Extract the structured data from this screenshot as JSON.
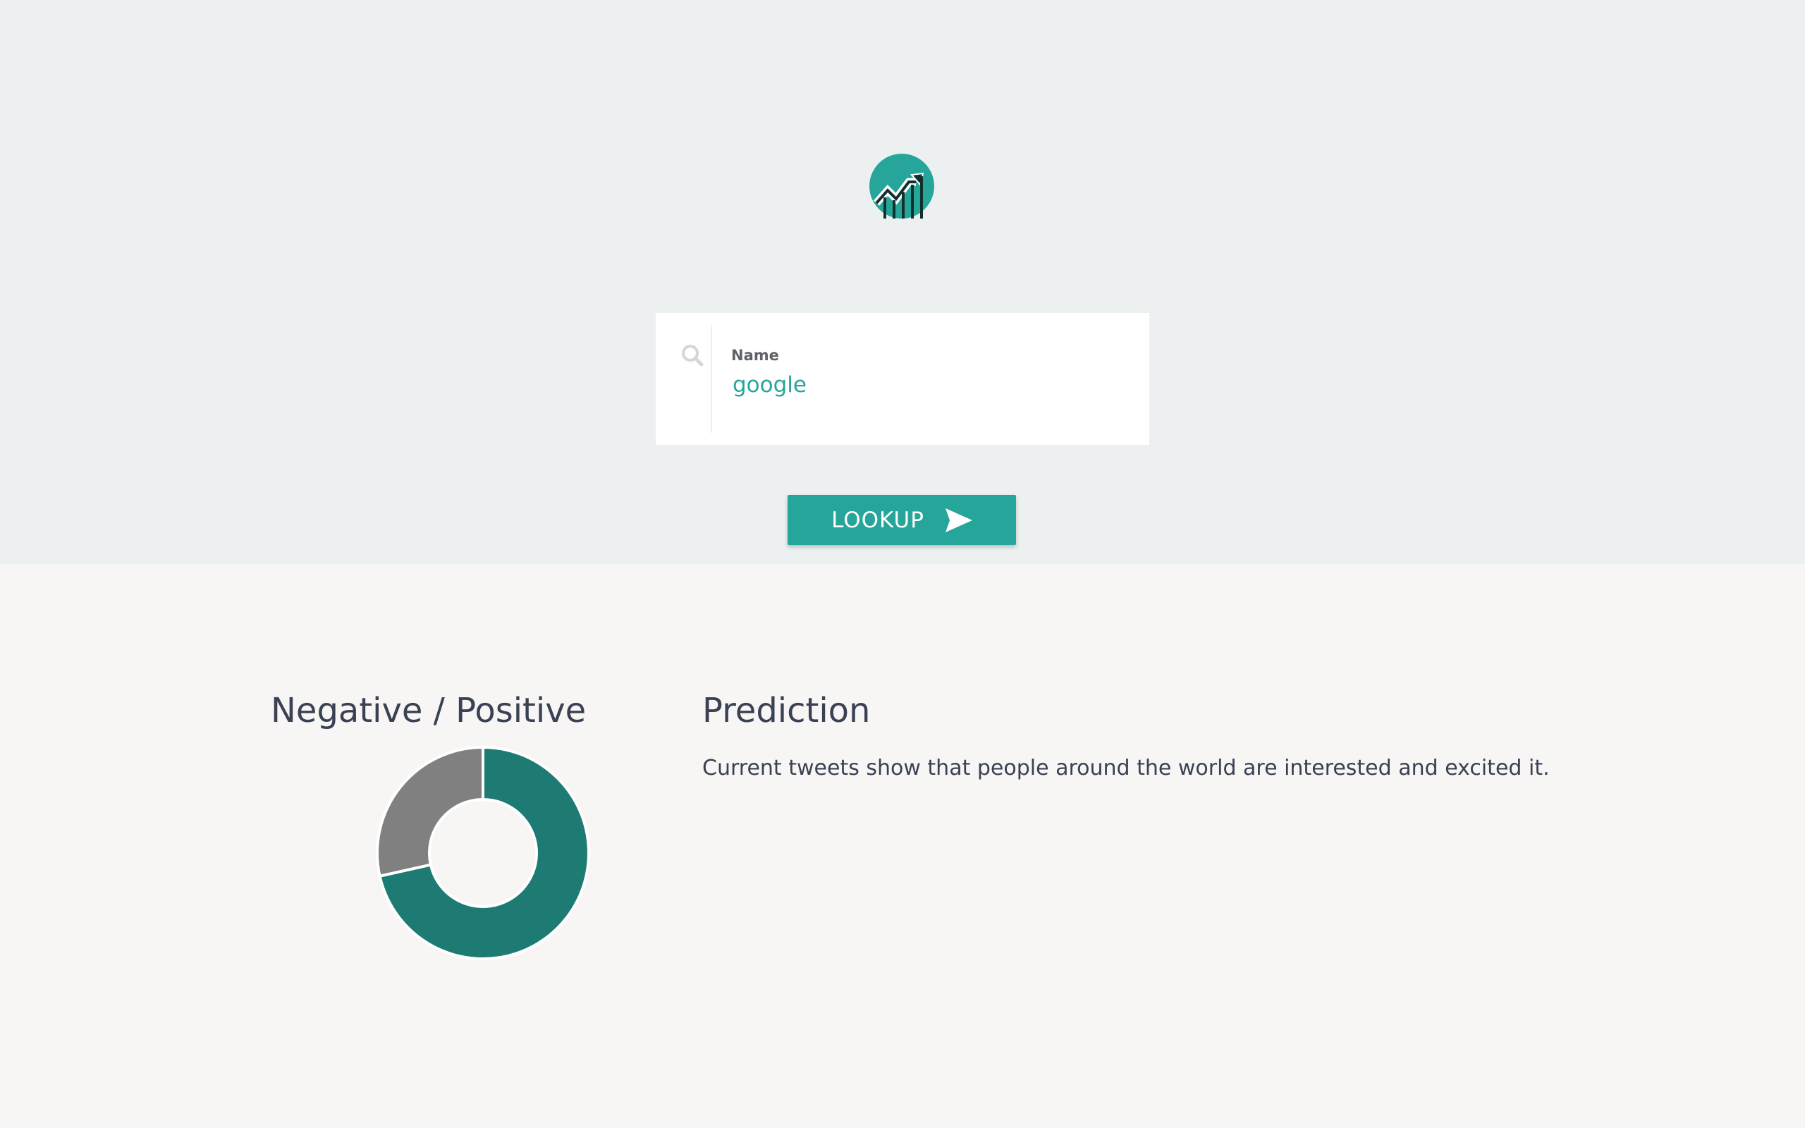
{
  "search": {
    "label": "Name",
    "value": "google"
  },
  "button": {
    "label": "LOOKUP"
  },
  "chart_section": {
    "title": "Negative / Positive"
  },
  "prediction": {
    "title": "Prediction",
    "text": "Current tweets show that people around the world are interested and excited it."
  },
  "colors": {
    "accent": "#26a69a",
    "positive": "#1d7b74",
    "negative": "#808080",
    "top_bg": "#ecf0f1",
    "bottom_bg": "#f7f6f5"
  },
  "chart_data": {
    "type": "pie",
    "title": "Negative / Positive",
    "donut": true,
    "categories": [
      "Negative",
      "Positive"
    ],
    "values": [
      28.5,
      71.5
    ],
    "colors": [
      "#808080",
      "#1d7b74"
    ]
  }
}
